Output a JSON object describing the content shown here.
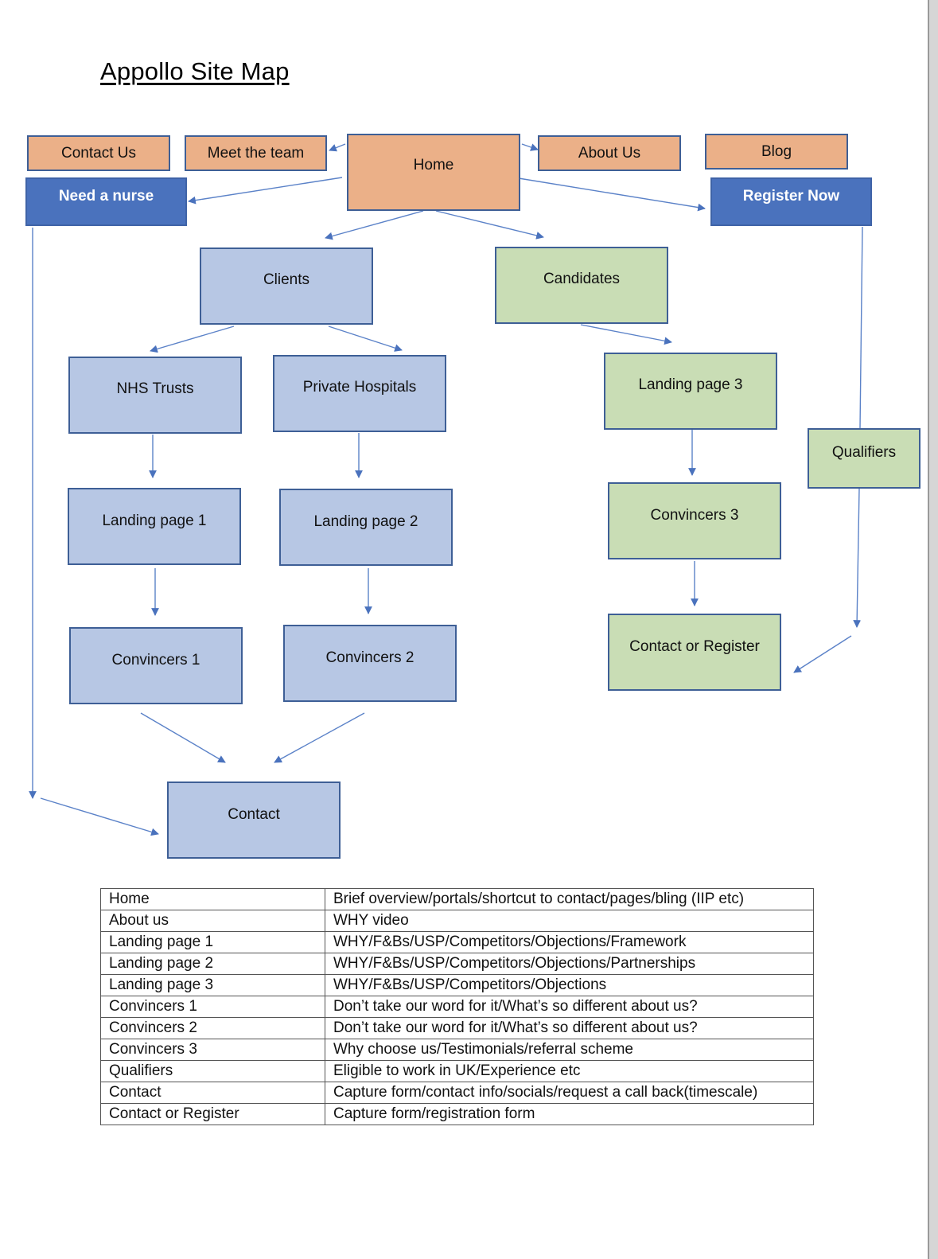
{
  "title": "Appollo Site Map",
  "nodes": {
    "contact_us": "Contact Us",
    "meet_the_team": "Meet the team",
    "home": "Home",
    "about_us": "About Us",
    "blog": "Blog",
    "need_a_nurse": "Need a nurse",
    "register_now": "Register Now",
    "clients": "Clients",
    "candidates": "Candidates",
    "nhs_trusts": "NHS Trusts",
    "private_hospitals": "Private Hospitals",
    "landing_page_1": "Landing page 1",
    "landing_page_2": "Landing page 2",
    "landing_page_3": "Landing page 3",
    "qualifiers": "Qualifiers",
    "convincers_1": "Convincers 1",
    "convincers_2": "Convincers 2",
    "convincers_3": "Convincers 3",
    "contact_or_register": "Contact or Register",
    "contact": "Contact"
  },
  "edges": [
    [
      "home",
      "meet_the_team"
    ],
    [
      "home",
      "about_us"
    ],
    [
      "home",
      "need_a_nurse"
    ],
    [
      "home",
      "register_now"
    ],
    [
      "home",
      "clients"
    ],
    [
      "home",
      "candidates"
    ],
    [
      "clients",
      "nhs_trusts"
    ],
    [
      "clients",
      "private_hospitals"
    ],
    [
      "nhs_trusts",
      "landing_page_1"
    ],
    [
      "private_hospitals",
      "landing_page_2"
    ],
    [
      "landing_page_1",
      "convincers_1"
    ],
    [
      "landing_page_2",
      "convincers_2"
    ],
    [
      "convincers_1",
      "contact"
    ],
    [
      "convincers_2",
      "contact"
    ],
    [
      "need_a_nurse",
      "contact"
    ],
    [
      "candidates",
      "landing_page_3"
    ],
    [
      "landing_page_3",
      "convincers_3"
    ],
    [
      "convincers_3",
      "contact_or_register"
    ],
    [
      "register_now",
      "qualifiers"
    ],
    [
      "qualifiers",
      "contact_or_register"
    ]
  ],
  "colors": {
    "orange": "#ebb088",
    "blue": "#4a72bd",
    "light_blue": "#b7c7e4",
    "green": "#c9ddb5",
    "arrow": "#4a72bd"
  },
  "table": {
    "rows": [
      {
        "page": "Home",
        "content": "Brief overview/portals/shortcut to contact/pages/bling (IIP etc)"
      },
      {
        "page": "About us",
        "content": "WHY video"
      },
      {
        "page": "Landing page 1",
        "content": "WHY/F&Bs/USP/Competitors/Objections/Framework"
      },
      {
        "page": "Landing page 2",
        "content": "WHY/F&Bs/USP/Competitors/Objections/Partnerships"
      },
      {
        "page": "Landing page 3",
        "content": "WHY/F&Bs/USP/Competitors/Objections"
      },
      {
        "page": "Convincers 1",
        "content": "Don’t take our word for it/What’s so different about us?"
      },
      {
        "page": "Convincers 2",
        "content": "Don’t take our word for it/What’s so different about us?"
      },
      {
        "page": "Convincers 3",
        "content": "Why choose us/Testimonials/referral scheme"
      },
      {
        "page": "Qualifiers",
        "content": "Eligible to work in UK/Experience etc"
      },
      {
        "page": "Contact",
        "content": "Capture form/contact info/socials/request a call back(timescale)"
      },
      {
        "page": "Contact or Register",
        "content": "Capture form/registration form"
      }
    ]
  }
}
